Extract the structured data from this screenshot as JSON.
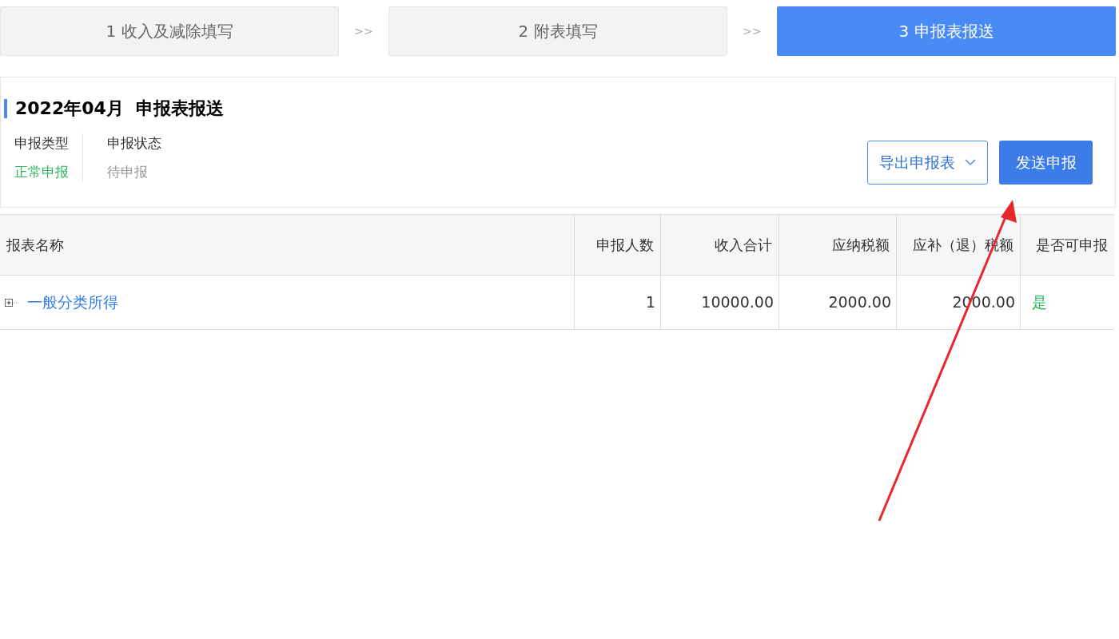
{
  "steps": [
    {
      "label": "1 收入及减除填写",
      "selected": false,
      "separator": ">>"
    },
    {
      "label": "2 附表填写",
      "selected": false,
      "separator": ">>"
    },
    {
      "label": "3 申报表报送",
      "selected": true
    }
  ],
  "header": {
    "title": "2022年04月  申报表报送",
    "info": [
      {
        "label": "申报类型",
        "value": "正常申报",
        "color": "#2db85c"
      },
      {
        "label": "申报状态",
        "value": "待申报",
        "color": "#999999"
      }
    ],
    "export_button": "导出申报表",
    "send_button": "发送申报"
  },
  "table": {
    "columns": [
      "报表名称",
      "申报人数",
      "收入合计",
      "应纳税额",
      "应补（退）税额",
      "是否可申报"
    ],
    "rows": [
      {
        "expanded": false,
        "cells": [
          "一般分类所得",
          "1",
          "10000.00",
          "2000.00",
          "2000.00",
          "是"
        ]
      }
    ]
  },
  "annotations": [
    {
      "kind": "arrow",
      "color": "#e8262b"
    }
  ]
}
